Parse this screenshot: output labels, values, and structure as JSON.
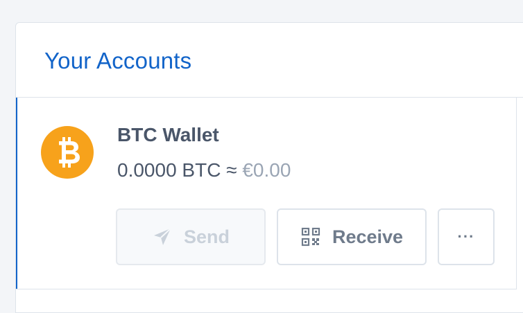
{
  "panel": {
    "title": "Your Accounts"
  },
  "account": {
    "name": "BTC Wallet",
    "balance_crypto": "0.0000 BTC",
    "approx_symbol": "≈",
    "balance_fiat": "€0.00",
    "coin_icon": "bitcoin-icon",
    "coin_color": "#f7a21b"
  },
  "actions": {
    "send_label": "Send",
    "send_icon": "paper-plane-icon",
    "send_disabled": true,
    "receive_label": "Receive",
    "receive_icon": "qr-code-icon",
    "more_label": "···"
  },
  "colors": {
    "accent": "#1264c9",
    "text": "#4a5669",
    "muted": "#9aa5b4",
    "border": "#dde3ea"
  }
}
